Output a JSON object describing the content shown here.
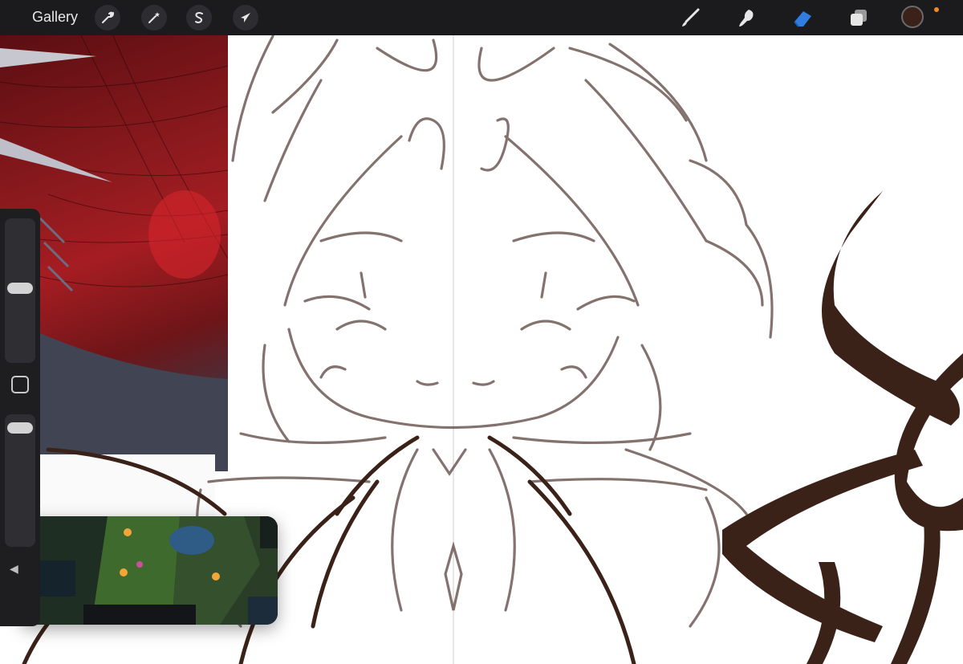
{
  "toolbar": {
    "gallery_label": "Gallery",
    "left_tools": [
      {
        "name": "actions",
        "icon": "wrench-icon"
      },
      {
        "name": "adjustments",
        "icon": "magic-wand-icon"
      },
      {
        "name": "selection",
        "icon": "selection-s-icon"
      },
      {
        "name": "transform",
        "icon": "arrow-cursor-icon"
      }
    ],
    "right_tools": [
      {
        "name": "brush",
        "icon": "brush-icon"
      },
      {
        "name": "smudge",
        "icon": "smudge-icon"
      },
      {
        "name": "eraser",
        "icon": "eraser-icon",
        "active": true
      },
      {
        "name": "layers",
        "icon": "layers-icon"
      }
    ],
    "current_color": "#3b2219",
    "active_tool_color": "#2f7de1",
    "recording_indicator_color": "#f08a24"
  },
  "sidebar": {
    "brush_size_level": 0.52,
    "opacity_level": 0.05,
    "modify_button_icon": "square-icon",
    "undo_icon": "undo-arrow-icon"
  },
  "canvas": {
    "sketch_color": "#6e5a55",
    "ink_color": "#3b2219",
    "symmetry_guide": "vertical"
  },
  "reference_window": {
    "content": "red-artwork-reference"
  },
  "pip_window": {
    "content": "game-video"
  }
}
